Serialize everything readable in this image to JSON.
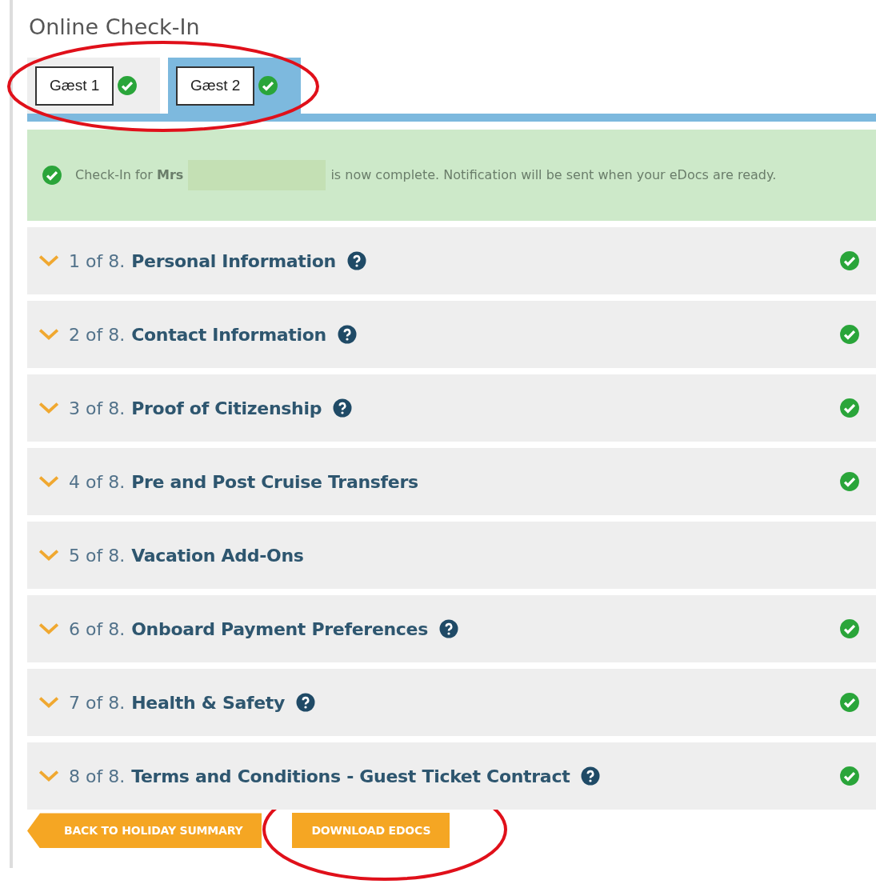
{
  "title": "Online Check-In",
  "guest_tabs": {
    "circled": true,
    "tabs": [
      {
        "label": "Gæst 1",
        "selected": false,
        "complete": true
      },
      {
        "label": "Gæst 2",
        "selected": true,
        "complete": true
      }
    ]
  },
  "alert": {
    "before": "Check-In for **Mrs**",
    "redacted": true,
    "after": "is now complete. Notification will be sent when your eDocs are ready."
  },
  "sections": [
    {
      "step": "1 of 8.",
      "title": "Personal Information",
      "help": true,
      "complete": true
    },
    {
      "step": "2 of 8.",
      "title": "Contact Information",
      "help": true,
      "complete": true
    },
    {
      "step": "3 of 8.",
      "title": "Proof of Citizenship",
      "help": true,
      "complete": true
    },
    {
      "step": "4 of 8.",
      "title": "Pre and Post Cruise Transfers",
      "help": false,
      "complete": true
    },
    {
      "step": "5 of 8.",
      "title": "Vacation Add-Ons",
      "help": false,
      "complete": false
    },
    {
      "step": "6 of 8.",
      "title": "Onboard Payment Preferences",
      "help": true,
      "complete": true
    },
    {
      "step": "7 of 8.",
      "title": "Health & Safety",
      "help": true,
      "complete": true
    },
    {
      "step": "8 of 8.",
      "title": "Terms and Conditions - Guest Ticket Contract",
      "help": true,
      "complete": true
    }
  ],
  "buttons": [
    {
      "kind": "back",
      "label": "BACK TO HOLIDAY SUMMARY",
      "circled": false
    },
    {
      "kind": "plain",
      "label": "DOWNLOAD EDOCS",
      "circled": true
    }
  ]
}
